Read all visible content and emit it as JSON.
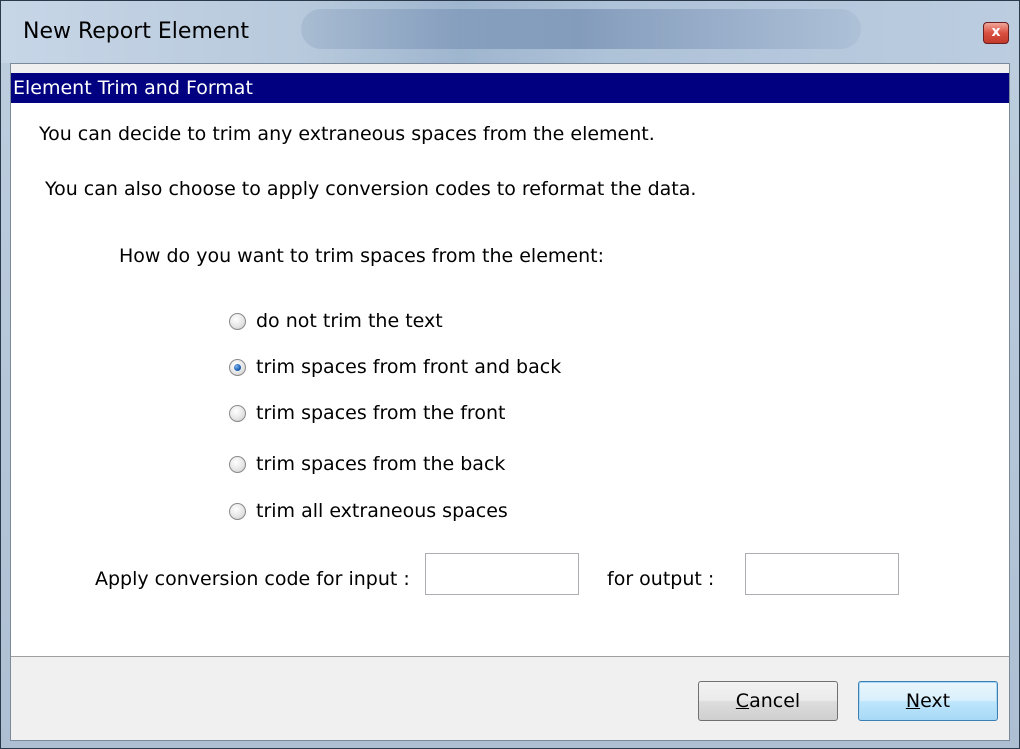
{
  "window": {
    "title": "New Report Element",
    "close_label": "x"
  },
  "header": {
    "title": "Element Trim and Format"
  },
  "intro": {
    "line1": "You can decide to trim any extraneous spaces from the element.",
    "line2": "You can also choose to apply conversion codes to reformat the data."
  },
  "trim": {
    "question": "How do you want to trim spaces from the element:",
    "options": [
      {
        "label": "do not trim the text",
        "checked": false
      },
      {
        "label": "trim spaces from front and back",
        "checked": true
      },
      {
        "label": "trim spaces from the front",
        "checked": false
      },
      {
        "label": "trim spaces from the back",
        "checked": false
      },
      {
        "label": "trim all extraneous spaces",
        "checked": false
      }
    ]
  },
  "conversion": {
    "input_label": "Apply conversion code for input :",
    "input_value": "",
    "output_label": "for output :",
    "output_value": ""
  },
  "buttons": {
    "cancel_mnemonic": "C",
    "cancel_rest": "ancel",
    "next_mnemonic": "N",
    "next_rest": "ext"
  },
  "colors": {
    "header_band": "#000080",
    "close_button": "#d9503f"
  }
}
